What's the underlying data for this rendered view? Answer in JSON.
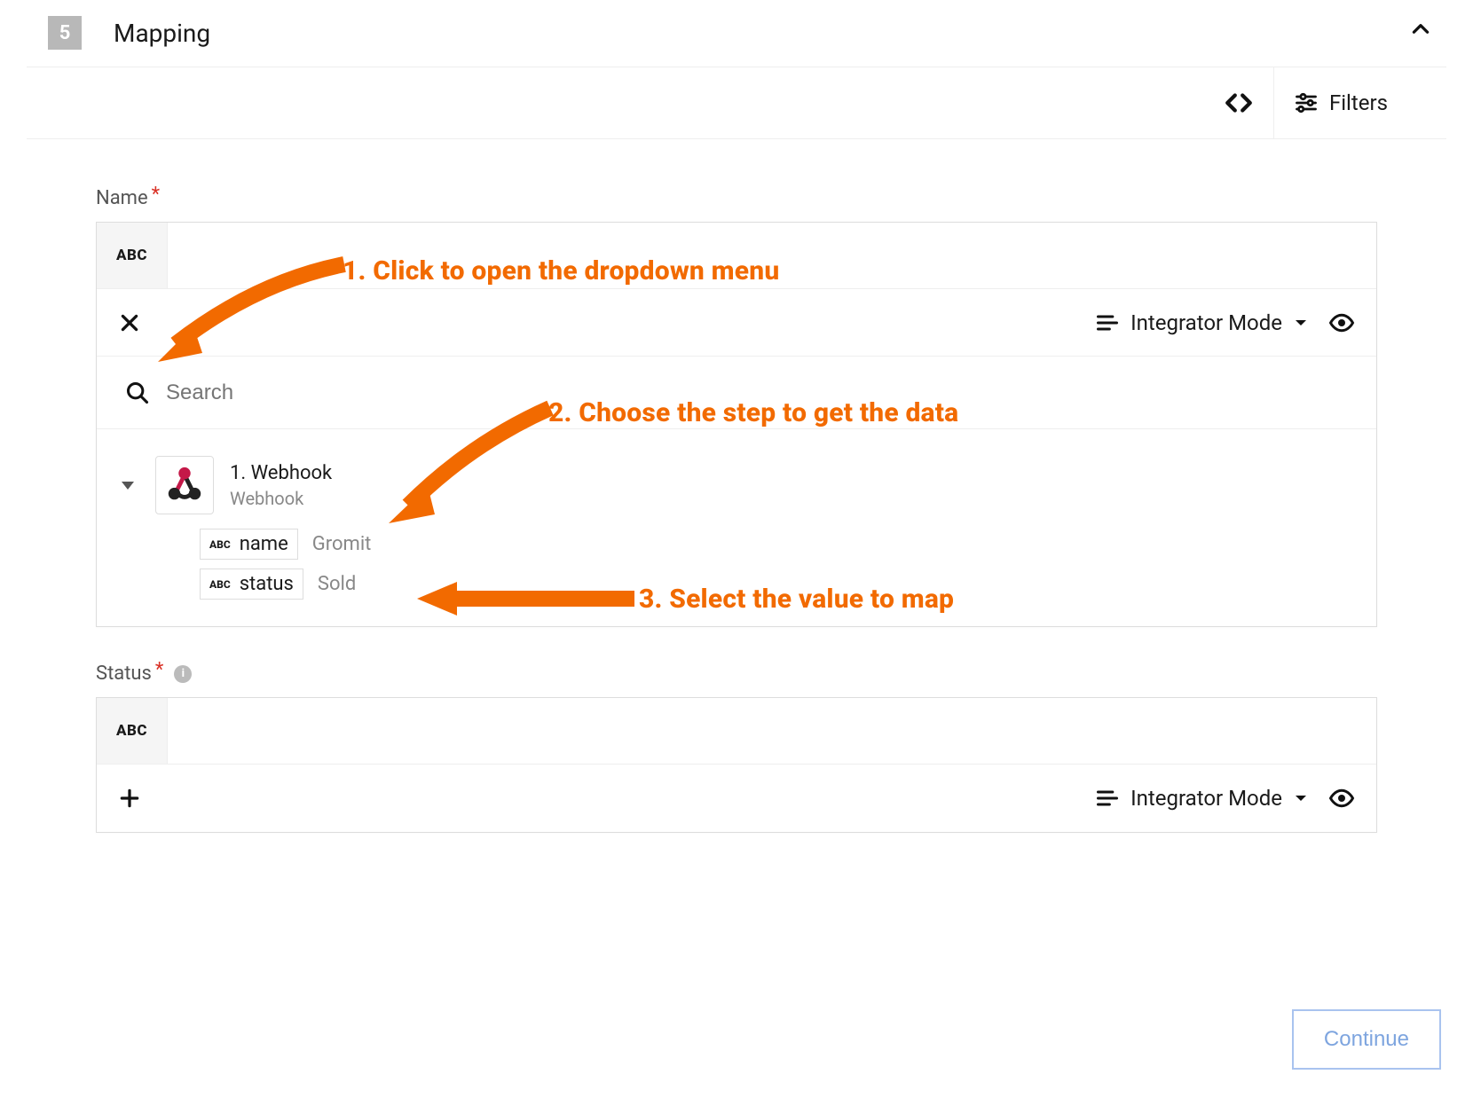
{
  "header": {
    "step_number": "5",
    "title": "Mapping"
  },
  "toolbar": {
    "filters_label": "Filters"
  },
  "fields": {
    "name": {
      "label": "Name",
      "required_mark": "*"
    },
    "status": {
      "label": "Status",
      "required_mark": "*"
    }
  },
  "modebar": {
    "mode_label": "Integrator Mode"
  },
  "search": {
    "placeholder": "Search"
  },
  "picker": {
    "step_title": "1. Webhook",
    "step_subtitle": "Webhook",
    "values": [
      {
        "type_badge": "ABC",
        "key": "name",
        "sample": "Gromit"
      },
      {
        "type_badge": "ABC",
        "key": "status",
        "sample": "Sold"
      }
    ]
  },
  "abc_badge": "ABC",
  "buttons": {
    "continue": "Continue"
  },
  "annotations": {
    "a1": "1. Click to open the dropdown menu",
    "a2": "2. Choose the step to get the data",
    "a3": "3. Select the value to map"
  }
}
